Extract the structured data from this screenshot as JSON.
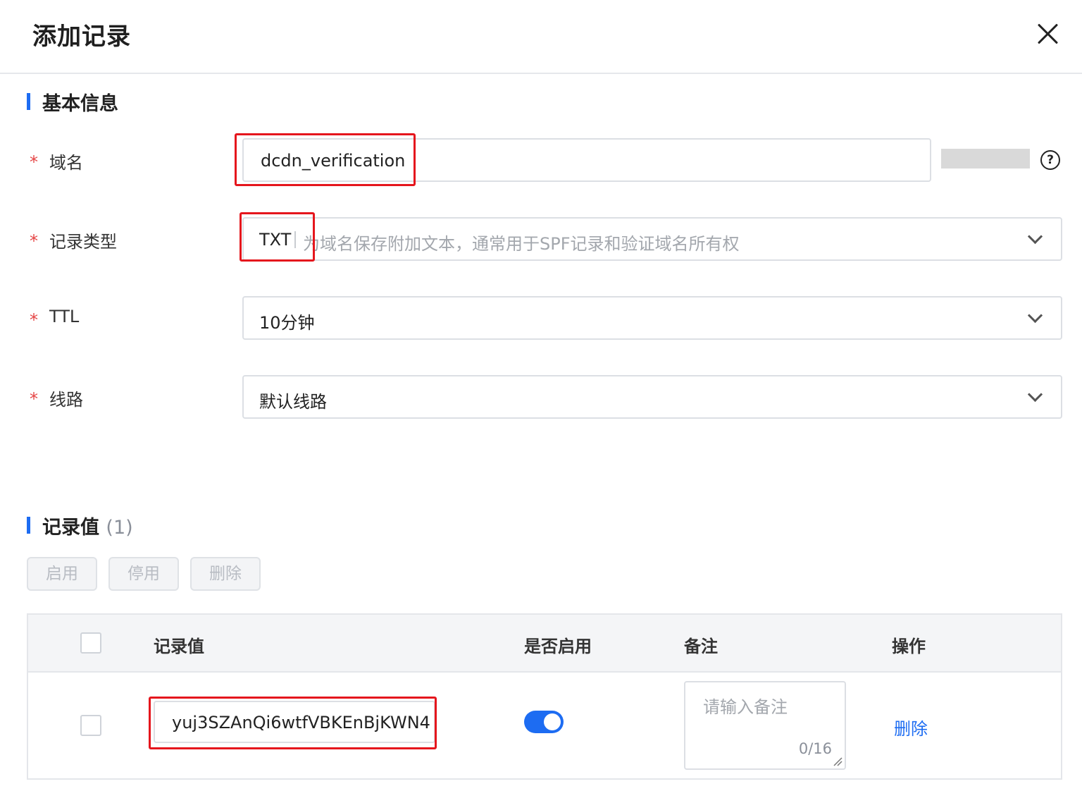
{
  "dialog": {
    "title": "添加记录"
  },
  "basic": {
    "section_title": "基本信息",
    "domain": {
      "label": "域名",
      "value": "dcdn_verification"
    },
    "record_type": {
      "label": "记录类型",
      "value": "TXT",
      "hint": "为域名保存附加文本，通常用于SPF记录和验证域名所有权"
    },
    "ttl": {
      "label": "TTL",
      "value": "10分钟"
    },
    "line": {
      "label": "线路",
      "value": "默认线路"
    },
    "required_mark": "*",
    "help_glyph": "?"
  },
  "records": {
    "section_title": "记录值",
    "count": "(1)",
    "buttons": {
      "enable": "启用",
      "disable": "停用",
      "delete": "删除"
    },
    "table": {
      "headers": {
        "value": "记录值",
        "enabled": "是否启用",
        "remark": "备注",
        "action": "操作"
      },
      "rows": [
        {
          "value": "yuj3SZAnQi6wtfVBKEnBjKWN4",
          "enabled": true,
          "remark_placeholder": "请输入备注",
          "counter": "0/16",
          "action": "删除"
        }
      ]
    }
  },
  "colors": {
    "accent": "#1d6cf2",
    "required": "#e54545",
    "highlight": "#e5161d"
  }
}
